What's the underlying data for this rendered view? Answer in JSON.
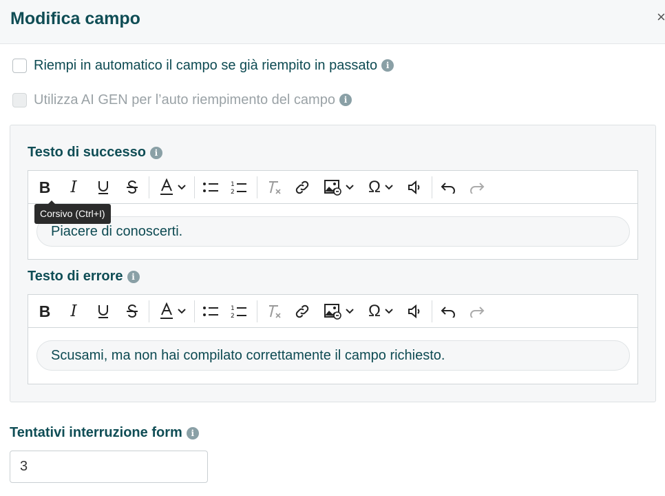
{
  "header": {
    "title": "Modifica campo",
    "close_label": "×"
  },
  "options": {
    "autofill_label": "Riempi in automatico il campo se già riempito in passato",
    "ai_gen_label": "Utilizza AI GEN per l’auto riempimento del campo"
  },
  "info_glyph": "i",
  "success": {
    "label": "Testo di successo",
    "text": "Piacere di conoscerti."
  },
  "error": {
    "label": "Testo di errore",
    "text": "Scusami, ma non hai compilato correttamente il campo richiesto."
  },
  "tooltip": "Corsivo (Ctrl+I)",
  "toolbar": {
    "bold": "B",
    "italic": "I",
    "omega": "Ω",
    "font_color": "A"
  },
  "attempts": {
    "label": "Tentativi interruzione form",
    "value": "3"
  },
  "colors": {
    "accent": "#0f4d55",
    "info": "#8aa0a6",
    "panel": "#f6f7f8"
  },
  "icons": [
    "bold-icon",
    "italic-icon",
    "underline-icon",
    "strikethrough-icon",
    "font-color-icon",
    "bullet-list-icon",
    "numbered-list-icon",
    "clear-format-icon",
    "link-icon",
    "image-icon",
    "special-char-icon",
    "audio-icon",
    "undo-icon",
    "redo-icon"
  ]
}
